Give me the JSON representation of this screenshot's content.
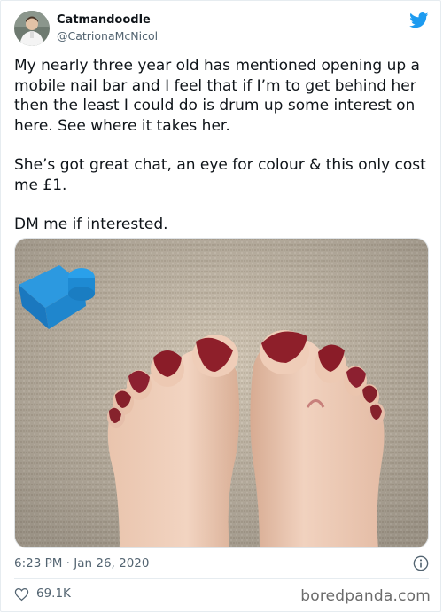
{
  "author": {
    "display_name": "Catmandoodle",
    "handle": "@CatrionaMcNicol"
  },
  "tweet": {
    "paragraphs": [
      "My nearly three year old has mentioned opening up a mobile nail bar and I feel that if I’m to get behind her then the least I could do is drum up some interest on here.  See where it takes her.",
      "She’s got great chat, an eye for colour & this only cost me £1.",
      "DM me if interested."
    ],
    "timestamp": "6:23 PM · Jan 26, 2020",
    "like_count": "69.1K"
  },
  "watermark": "boredpanda.com",
  "icons": {
    "brand": "twitter-bird-icon",
    "info": "info-icon",
    "like": "heart-icon"
  },
  "colors": {
    "twitter_blue": "#1d9bf0",
    "text_primary": "#0f1419",
    "text_secondary": "#536471",
    "glitter_polish": "#8e1f2a",
    "toy_block": "#1f8fd8"
  }
}
